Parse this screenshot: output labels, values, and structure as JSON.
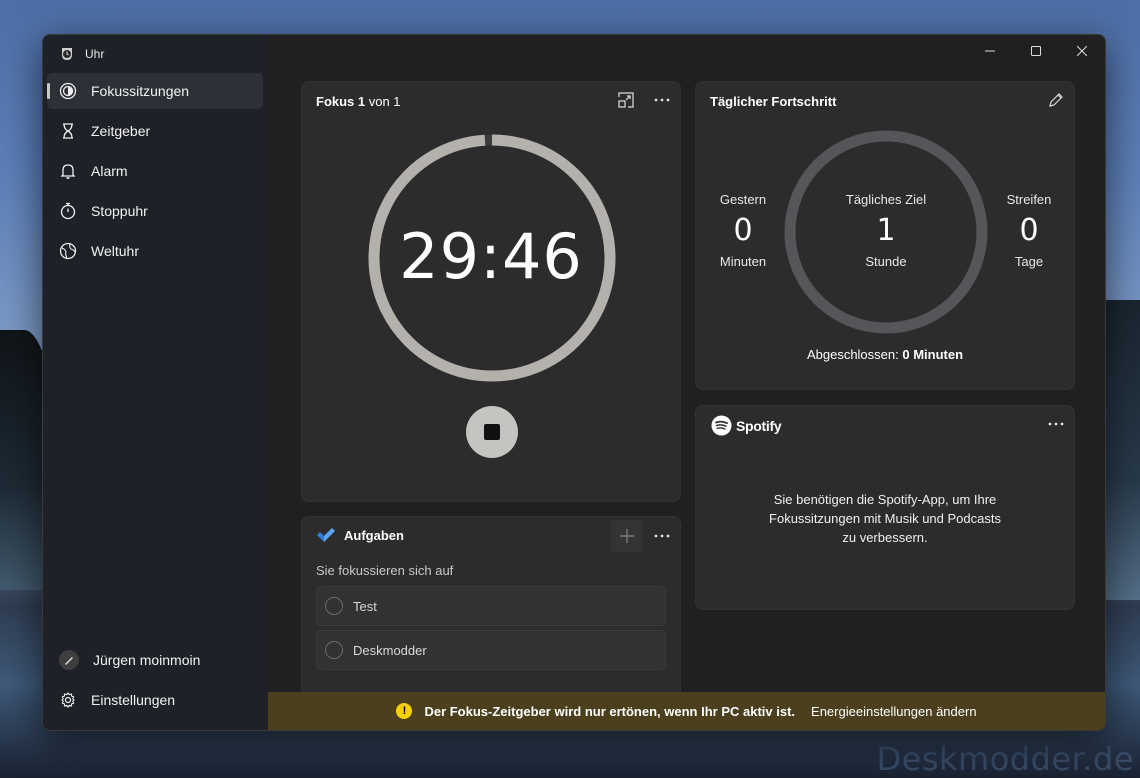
{
  "window": {
    "title": "Uhr",
    "controls": {
      "minimize": "minimize-icon",
      "maximize": "maximize-icon",
      "close": "close-icon"
    }
  },
  "sidebar": {
    "items": [
      {
        "label": "Fokussitzungen",
        "icon": "focus-icon",
        "active": true
      },
      {
        "label": "Zeitgeber",
        "icon": "hourglass-icon",
        "active": false
      },
      {
        "label": "Alarm",
        "icon": "bell-icon",
        "active": false
      },
      {
        "label": "Stoppuhr",
        "icon": "stopwatch-icon",
        "active": false
      },
      {
        "label": "Weltuhr",
        "icon": "globe-icon",
        "active": false
      }
    ],
    "account": {
      "label": "Jürgen moinmoin"
    },
    "settings": {
      "label": "Einstellungen"
    }
  },
  "focus_card": {
    "title_bold": "Fokus 1",
    "title_rest": " von 1",
    "timer": "29:46",
    "progress": 0.99
  },
  "daily_card": {
    "title": "Täglicher Fortschritt",
    "yesterday": {
      "label": "Gestern",
      "value": "0",
      "unit": "Minuten"
    },
    "goal": {
      "label": "Tägliches Ziel",
      "value": "1",
      "unit": "Stunde"
    },
    "streak": {
      "label": "Streifen",
      "value": "0",
      "unit": "Tage"
    },
    "completed_label": "Abgeschlossen: ",
    "completed_value": "0 Minuten"
  },
  "tasks_card": {
    "title": "Aufgaben",
    "subtitle": "Sie fokussieren sich auf",
    "tasks": [
      "Test",
      "Deskmodder"
    ]
  },
  "spotify_card": {
    "brand": "Spotify",
    "message_lines": [
      "Sie benötigen die Spotify-App, um Ihre",
      "Fokussitzungen mit Musik und Podcasts",
      "zu verbessern."
    ]
  },
  "notice": {
    "text": "Der Fokus-Zeitgeber wird nur ertönen, wenn Ihr PC aktiv ist.",
    "link": "Energieeinstellungen ändern"
  },
  "watermark": "Deskmodder.de",
  "colors": {
    "sidebar_bg": "#1e2127",
    "card_bg": "#2c2c2c",
    "ring_focus": "#b4b1ad",
    "ring_daily": "#555659",
    "notice_bg": "#4b3f1d",
    "warn_yellow": "#f5d100",
    "task_accent": "#2f7fd8"
  }
}
